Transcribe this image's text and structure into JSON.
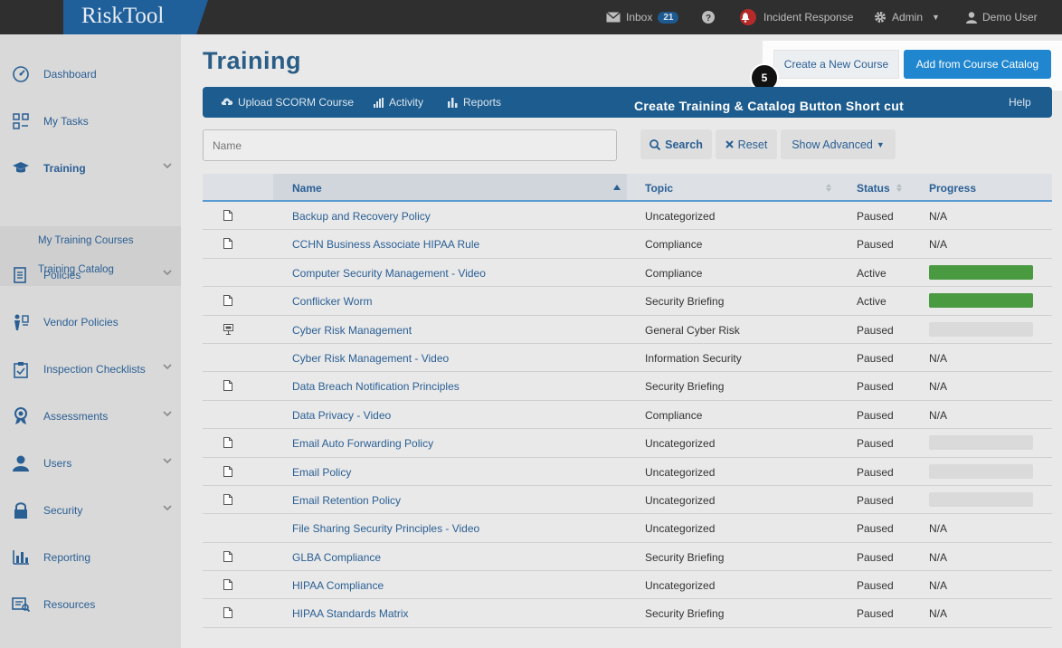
{
  "app": {
    "logo": "RiskTool"
  },
  "topnav": {
    "inbox_label": "Inbox",
    "inbox_count": "21",
    "incident_label": "Incident Response",
    "admin_label": "Admin",
    "user_label": "Demo User"
  },
  "sidebar": {
    "items": [
      {
        "label": "Dashboard",
        "icon": "dashboard-icon"
      },
      {
        "label": "My Tasks",
        "icon": "tasks-icon"
      },
      {
        "label": "Training",
        "icon": "graduation-cap-icon"
      },
      {
        "label": "Policies",
        "icon": "policy-document-icon"
      },
      {
        "label": "Vendor Policies",
        "icon": "vendor-users-icon"
      },
      {
        "label": "Inspection Checklists",
        "icon": "checklist-icon"
      },
      {
        "label": "Assessments",
        "icon": "award-icon"
      },
      {
        "label": "Users",
        "icon": "user-icon"
      },
      {
        "label": "Security",
        "icon": "lock-icon"
      },
      {
        "label": "Reporting",
        "icon": "bar-chart-icon"
      },
      {
        "label": "Resources",
        "icon": "resources-icon"
      }
    ],
    "sub_items": [
      "My Training Courses",
      "Training Catalog"
    ]
  },
  "main": {
    "title": "Training",
    "create_label": "Create a New Course",
    "catalog_label": "Add from Course Catalog",
    "step_number": "5",
    "toolbar": {
      "upload_label": "Upload SCORM Course",
      "activity_label": "Activity",
      "reports_label": "Reports",
      "caption": "Create Training & Catalog Button Short cut",
      "help_label": "Help"
    },
    "search": {
      "placeholder": "Name",
      "search_label": "Search",
      "reset_label": "Reset",
      "advanced_label": "Show Advanced"
    },
    "table": {
      "headers": {
        "name": "Name",
        "topic": "Topic",
        "status": "Status",
        "progress": "Progress"
      },
      "progress_color": "#4a9a42",
      "rows": [
        {
          "icon": "document-icon",
          "name": "Backup and Recovery Policy",
          "topic": "Uncategorized",
          "status": "Paused",
          "progress": "N/A"
        },
        {
          "icon": "document-icon",
          "name": "CCHN Business Associate HIPAA Rule",
          "topic": "Compliance",
          "status": "Paused",
          "progress": "N/A"
        },
        {
          "icon": "",
          "name": "Computer Security Management - Video",
          "topic": "Compliance",
          "status": "Active",
          "progress_value": 1.0
        },
        {
          "icon": "document-icon",
          "name": "Conflicker Worm",
          "topic": "Security Briefing",
          "status": "Active",
          "progress_value": 1.0
        },
        {
          "icon": "presentation-icon",
          "name": "Cyber Risk Management",
          "topic": "General Cyber Risk",
          "status": "Paused",
          "progress_value": 0.0
        },
        {
          "icon": "",
          "name": "Cyber Risk Management - Video",
          "topic": "Information Security",
          "status": "Paused",
          "progress": "N/A"
        },
        {
          "icon": "document-icon",
          "name": "Data Breach Notification Principles",
          "topic": "Security Briefing",
          "status": "Paused",
          "progress": "N/A"
        },
        {
          "icon": "",
          "name": "Data Privacy - Video",
          "topic": "Compliance",
          "status": "Paused",
          "progress": "N/A"
        },
        {
          "icon": "document-icon",
          "name": "Email Auto Forwarding Policy",
          "topic": "Uncategorized",
          "status": "Paused",
          "progress_value": 0.0
        },
        {
          "icon": "document-icon",
          "name": "Email Policy",
          "topic": "Uncategorized",
          "status": "Paused",
          "progress_value": 0.0
        },
        {
          "icon": "document-icon",
          "name": "Email Retention Policy",
          "topic": "Uncategorized",
          "status": "Paused",
          "progress_value": 0.0
        },
        {
          "icon": "",
          "name": "File Sharing Security Principles - Video",
          "topic": "Uncategorized",
          "status": "Paused",
          "progress": "N/A"
        },
        {
          "icon": "document-icon",
          "name": "GLBA Compliance",
          "topic": "Security Briefing",
          "status": "Paused",
          "progress": "N/A"
        },
        {
          "icon": "document-icon",
          "name": "HIPAA Compliance",
          "topic": "Uncategorized",
          "status": "Paused",
          "progress": "N/A"
        },
        {
          "icon": "document-icon",
          "name": "HIPAA Standards Matrix",
          "topic": "Security Briefing",
          "status": "Paused",
          "progress": "N/A"
        }
      ]
    }
  }
}
